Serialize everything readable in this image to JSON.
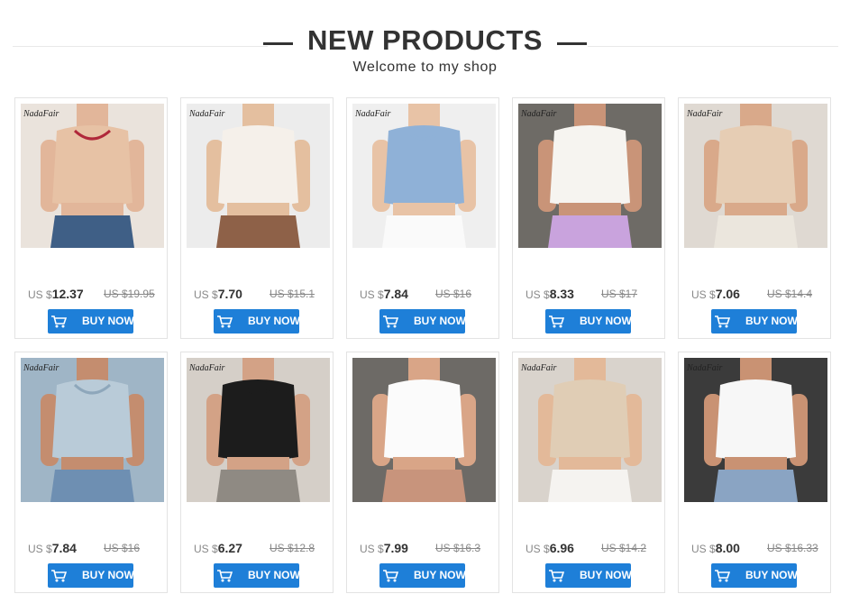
{
  "header": {
    "title": "NEW PRODUCTS",
    "subtitle": "Welcome to my shop"
  },
  "colors": {
    "button": "#1e7fd8",
    "text": "#333333",
    "muted": "#888888"
  },
  "products": [
    {
      "brand": "NadaFair",
      "currency": "US $",
      "price": "12.37",
      "old_price": "US $19.95",
      "button": "BUY NOW",
      "bg": "#eae3dc",
      "garment": "#e7c2a5",
      "garment2": "#b0283a",
      "bottom": "#3f5f86",
      "skin": "#e2b69a"
    },
    {
      "brand": "NadaFair",
      "currency": "US $",
      "price": "7.70",
      "old_price": "US $15.1",
      "button": "BUY NOW",
      "bg": "#ececec",
      "garment": "#f5f0ea",
      "garment2": "#f5f0ea",
      "bottom": "#8e6148",
      "skin": "#e4bf9f"
    },
    {
      "brand": "NadaFair",
      "currency": "US $",
      "price": "7.84",
      "old_price": "US $16",
      "button": "BUY NOW",
      "bg": "#efefef",
      "garment": "#8fb1d7",
      "garment2": "#8fb1d7",
      "bottom": "#fafafa",
      "skin": "#e8c3a6"
    },
    {
      "brand": "NadaFair",
      "currency": "US $",
      "price": "8.33",
      "old_price": "US $17",
      "button": "BUY NOW",
      "bg": "#6e6b66",
      "garment": "#f6f4f0",
      "garment2": "#f6f4f0",
      "bottom": "#c9a3dd",
      "skin": "#c99478"
    },
    {
      "brand": "NadaFair",
      "currency": "US $",
      "price": "7.06",
      "old_price": "US $14.4",
      "button": "BUY NOW",
      "bg": "#dfd9d2",
      "garment": "#e6cdb4",
      "garment2": "#e6cdb4",
      "bottom": "#ebe6dd",
      "skin": "#d9a98a"
    },
    {
      "brand": "NadaFair",
      "currency": "US $",
      "price": "7.84",
      "old_price": "US $16",
      "button": "BUY NOW",
      "bg": "#9fb5c6",
      "garment": "#b9cbd8",
      "garment2": "#8ea7bb",
      "bottom": "#6e8fb2",
      "skin": "#c48d6f"
    },
    {
      "brand": "NadaFair",
      "currency": "US $",
      "price": "6.27",
      "old_price": "US $12.8",
      "button": "BUY NOW",
      "bg": "#d5cfc8",
      "garment": "#1c1c1c",
      "garment2": "#1c1c1c",
      "bottom": "#8f8a83",
      "skin": "#d3a286"
    },
    {
      "brand": "",
      "currency": "US $",
      "price": "7.99",
      "old_price": "US $16.3",
      "button": "BUY NOW",
      "bg": "#6d6a66",
      "garment": "#fbfbfb",
      "garment2": "#fbfbfb",
      "bottom": "#c8947c",
      "skin": "#d9a587"
    },
    {
      "brand": "NadaFair",
      "currency": "US $",
      "price": "6.96",
      "old_price": "US $14.2",
      "button": "BUY NOW",
      "bg": "#d9d3cc",
      "garment": "#e0cdb5",
      "garment2": "#e0cdb5",
      "bottom": "#f5f3f0",
      "skin": "#e3b999"
    },
    {
      "brand": "NadaFair",
      "currency": "US $",
      "price": "8.00",
      "old_price": "US $16.33",
      "button": "BUY NOW",
      "bg": "#3b3b3b",
      "garment": "#f7f7f7",
      "garment2": "#f7f7f7",
      "bottom": "#8aa4c3",
      "skin": "#c99273"
    }
  ]
}
